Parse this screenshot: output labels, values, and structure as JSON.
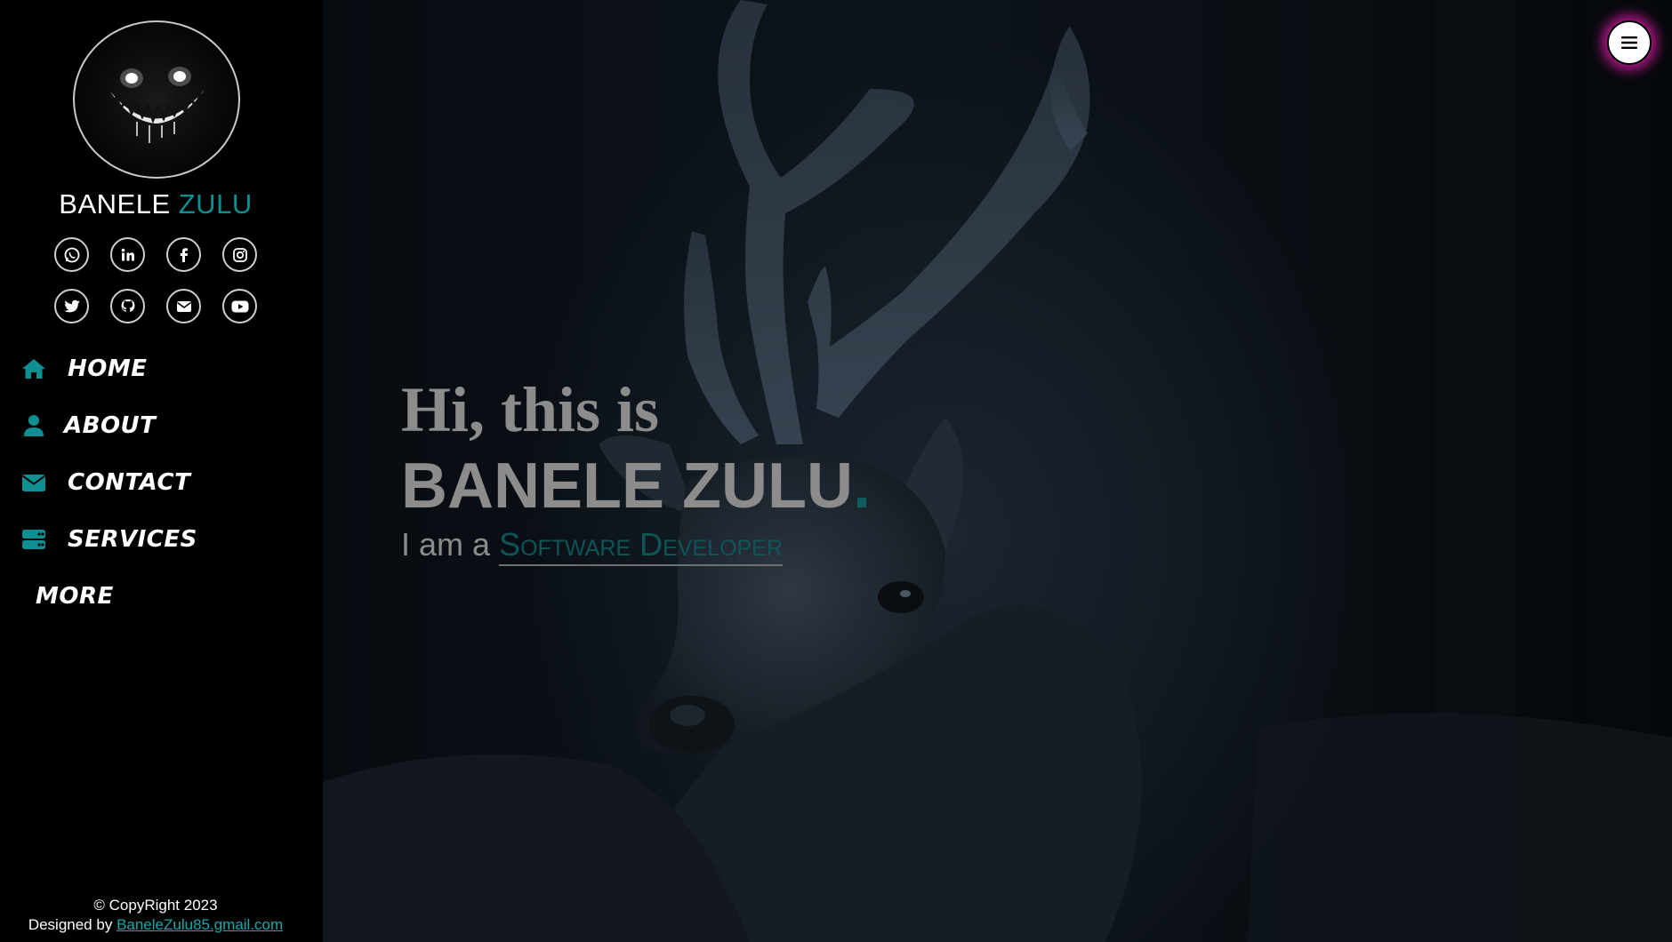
{
  "sidebar": {
    "brand": {
      "first": "BANELE",
      "last": "ZULU"
    },
    "social": [
      {
        "name": "whatsapp-icon"
      },
      {
        "name": "linkedin-icon"
      },
      {
        "name": "facebook-icon"
      },
      {
        "name": "instagram-icon"
      },
      {
        "name": "twitter-icon"
      },
      {
        "name": "github-icon"
      },
      {
        "name": "email-icon"
      },
      {
        "name": "youtube-icon"
      }
    ],
    "nav": [
      {
        "label": "HOME",
        "icon": "home-icon"
      },
      {
        "label": "ABOUT",
        "icon": "user-icon"
      },
      {
        "label": "CONTACT",
        "icon": "envelope-icon"
      },
      {
        "label": "SERVICES",
        "icon": "server-icon"
      },
      {
        "label": "MORE"
      }
    ],
    "footer": {
      "copyright": "© CopyRight 2023",
      "designed_by": "Designed by",
      "email": "BaneleZulu85.gmail.com"
    }
  },
  "hero": {
    "greeting": "Hi, this is",
    "name": "BANELE ZULU",
    "name_dot": ".",
    "role_prefix": "I am a",
    "role": "Software Developer"
  },
  "colors": {
    "accent": "#0e8f92",
    "menu_glow": "#e21bab",
    "background": "#000000"
  }
}
